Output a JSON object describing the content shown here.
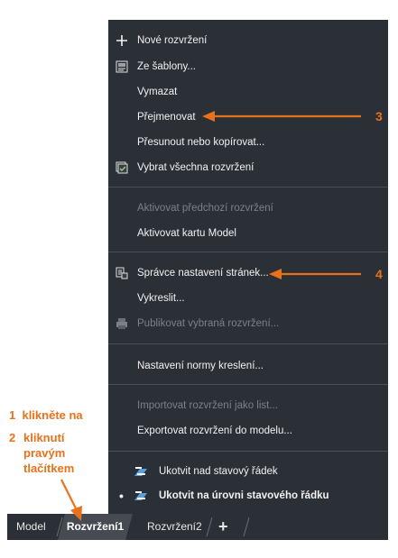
{
  "menu": {
    "items": [
      {
        "label": "Nové rozvržení",
        "icon": "plus-icon",
        "disabled": false
      },
      {
        "label": "Ze šablony...",
        "icon": "template-icon",
        "disabled": false
      },
      {
        "label": "Vymazat",
        "icon": "",
        "disabled": false
      },
      {
        "label": "Přejmenovat",
        "icon": "",
        "disabled": false
      },
      {
        "label": "Přesunout nebo kopírovat...",
        "icon": "",
        "disabled": false
      },
      {
        "label": "Vybrat všechna rozvržení",
        "icon": "select-all-icon",
        "disabled": false
      },
      {
        "label": "Aktivovat předchozí rozvržení",
        "icon": "",
        "disabled": true
      },
      {
        "label": "Aktivovat kartu Model",
        "icon": "",
        "disabled": false
      },
      {
        "label": "Správce nastavení stránek...",
        "icon": "page-setup-icon",
        "disabled": false
      },
      {
        "label": "Vykreslit...",
        "icon": "",
        "disabled": false
      },
      {
        "label": "Publikovat vybraná rozvržení...",
        "icon": "publish-icon",
        "disabled": true
      },
      {
        "label": "Nastavení normy kreslení...",
        "icon": "",
        "disabled": false
      },
      {
        "label": "Importovat rozvržení jako list...",
        "icon": "",
        "disabled": true
      },
      {
        "label": "Exportovat rozvržení do modelu...",
        "icon": "",
        "disabled": false
      },
      {
        "label": "Ukotvit nad stavový řádek",
        "icon": "dock-icon",
        "disabled": false
      },
      {
        "label": "Ukotvit na úrovni stavového řádku",
        "icon": "dock-icon",
        "disabled": false,
        "checked": true
      }
    ]
  },
  "tabs": {
    "model": "Model",
    "layout1": "Rozvržení1",
    "layout2": "Rozvržení2",
    "add": "+"
  },
  "callouts": {
    "rename_number": "3",
    "page_setup_number": "4",
    "step1_number": "1",
    "step1_text": "klikněte na",
    "step2_number": "2",
    "step2_line1": "kliknutí",
    "step2_line2": "pravým",
    "step2_line3": "tlačítkem"
  },
  "colors": {
    "menu_bg": "#2b2f36",
    "accent": "#e8711c",
    "disabled_text": "#7d8187"
  }
}
